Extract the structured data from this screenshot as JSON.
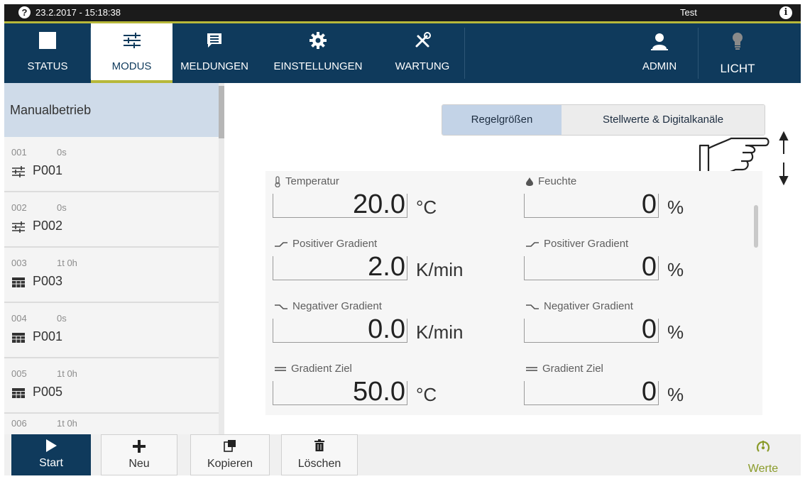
{
  "statusbar": {
    "datetime": "23.2.2017 - 15:18:38",
    "user": "Test",
    "help_glyph": "?",
    "info_glyph": "i"
  },
  "nav": {
    "tabs": [
      {
        "label": "STATUS",
        "icon": "stop-square-icon"
      },
      {
        "label": "MODUS",
        "icon": "sliders-icon",
        "active": true
      },
      {
        "label": "MELDUNGEN",
        "icon": "message-icon"
      },
      {
        "label": "EINSTELLUNGEN",
        "icon": "gear-icon"
      },
      {
        "label": "WARTUNG",
        "icon": "tools-icon"
      },
      {
        "label": "ADMIN",
        "icon": "user-icon"
      },
      {
        "label": "LICHT",
        "icon": "lightbulb-icon"
      }
    ]
  },
  "sidebar": {
    "header": "Manualbetrieb",
    "items": [
      {
        "num": "001",
        "duration": "0s",
        "name": "P001",
        "icon": "sliders-icon"
      },
      {
        "num": "002",
        "duration": "0s",
        "name": "P002",
        "icon": "sliders-icon"
      },
      {
        "num": "003",
        "duration": "1t 0h",
        "name": "P003",
        "icon": "table-icon"
      },
      {
        "num": "004",
        "duration": "0s",
        "name": "P001",
        "icon": "table-icon"
      },
      {
        "num": "005",
        "duration": "1t 0h",
        "name": "P005",
        "icon": "table-icon"
      },
      {
        "num": "006",
        "duration": "1t 0h",
        "name": "",
        "icon": ""
      }
    ]
  },
  "main": {
    "segments": {
      "active": "Regelgrößen",
      "other": "Stellwerte & Digitalkanäle"
    },
    "left": [
      {
        "title": "Temperatur",
        "value": "20.0",
        "unit": "°C",
        "icon": "thermometer-icon"
      },
      {
        "title": "Positiver Gradient",
        "value": "2.0",
        "unit": "K/min",
        "icon": "rising-gradient-icon"
      },
      {
        "title": "Negativer Gradient",
        "value": "0.0",
        "unit": "K/min",
        "icon": "falling-gradient-icon"
      },
      {
        "title": "Gradient Ziel",
        "value": "50.0",
        "unit": "°C",
        "icon": "target-gradient-icon"
      }
    ],
    "right": [
      {
        "title": "Feuchte",
        "value": "0",
        "unit": "%",
        "icon": "droplet-icon"
      },
      {
        "title": "Positiver Gradient",
        "value": "0",
        "unit": "%",
        "icon": "rising-gradient-icon"
      },
      {
        "title": "Negativer Gradient",
        "value": "0",
        "unit": "%",
        "icon": "falling-gradient-icon"
      },
      {
        "title": "Gradient Ziel",
        "value": "0",
        "unit": "%",
        "icon": "target-gradient-icon"
      }
    ]
  },
  "bottombar": {
    "start": "Start",
    "new": "Neu",
    "copy": "Kopieren",
    "delete": "Löschen",
    "values": "Werte"
  },
  "colors": {
    "nav": "#0f3a5c",
    "accent": "#b7b83a",
    "active_segment": "#c3d3e7",
    "werte": "#8a9b2a"
  }
}
